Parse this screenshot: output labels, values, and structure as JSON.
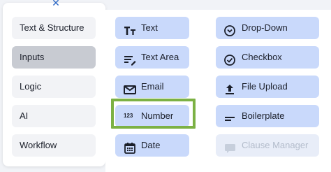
{
  "left_panel": {
    "close_glyph": "✕",
    "categories": [
      {
        "label": "Text & Structure",
        "active": false
      },
      {
        "label": "Inputs",
        "active": true
      },
      {
        "label": "Logic",
        "active": false
      },
      {
        "label": "AI",
        "active": false
      },
      {
        "label": "Workflow",
        "active": false
      }
    ]
  },
  "fields": {
    "col1": [
      {
        "label": "Text",
        "icon": "text-format-icon",
        "glyph": "Tт"
      },
      {
        "label": "Text Area",
        "icon": "text-area-icon",
        "glyph": "≡"
      },
      {
        "label": "Email",
        "icon": "email-icon",
        "glyph": "✉"
      },
      {
        "label": "Number",
        "icon": "number-icon",
        "glyph": "123",
        "highlighted": true
      },
      {
        "label": "Date",
        "icon": "calendar-icon",
        "glyph": "▦"
      }
    ],
    "col2": [
      {
        "label": "Drop-Down",
        "icon": "dropdown-icon",
        "glyph": "⌄"
      },
      {
        "label": "Checkbox",
        "icon": "checkbox-icon",
        "glyph": "✓"
      },
      {
        "label": "File Upload",
        "icon": "upload-icon",
        "glyph": "⇧"
      },
      {
        "label": "Boilerplate",
        "icon": "boilerplate-icon",
        "glyph": "☰"
      },
      {
        "label": "Clause Manager",
        "icon": "clause-manager-icon",
        "glyph": "▭",
        "disabled": true
      }
    ]
  },
  "colors": {
    "accent": "#2a66c4",
    "field_bg": "#c9d9fb",
    "highlight": "#7cb144",
    "active_category": "#c8cbd2"
  }
}
